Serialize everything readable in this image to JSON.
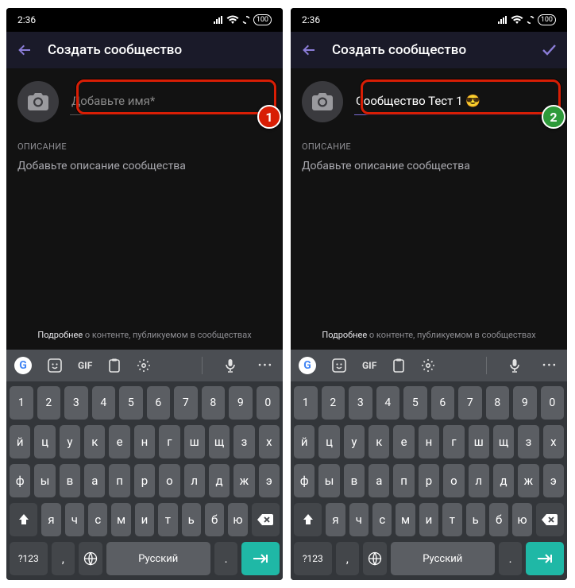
{
  "statusbar": {
    "time": "2:36",
    "battery": "100"
  },
  "header": {
    "title": "Создать сообщество"
  },
  "nameField": {
    "placeholder": "Добавьте имя*",
    "valueLeft": "",
    "valueRight": "Сообщество Тест 1 😎"
  },
  "section": {
    "descLabel": "ОПИСАНИЕ"
  },
  "descField": {
    "placeholder": "Добавьте описание сообщества"
  },
  "footer": {
    "bold": "Подробнее",
    "rest": " о контенте, публикуемом в сообществах"
  },
  "badges": {
    "left": "1",
    "right": "2"
  },
  "kbStrip": {
    "gif": "GIF"
  },
  "keyboard": {
    "numRow": [
      "1",
      "2",
      "3",
      "4",
      "5",
      "6",
      "7",
      "8",
      "9",
      "0"
    ],
    "row1": [
      "й",
      "ц",
      "у",
      "к",
      "е",
      "н",
      "г",
      "ш",
      "щ",
      "з",
      "х"
    ],
    "row2": [
      "ф",
      "ы",
      "в",
      "а",
      "п",
      "р",
      "о",
      "л",
      "д",
      "ж",
      "э"
    ],
    "row3": [
      "я",
      "ч",
      "с",
      "м",
      "и",
      "т",
      "ь",
      "б",
      "ю"
    ],
    "symKey": "?123",
    "langLabel": "Русский",
    "comma": ",",
    "period": "."
  }
}
